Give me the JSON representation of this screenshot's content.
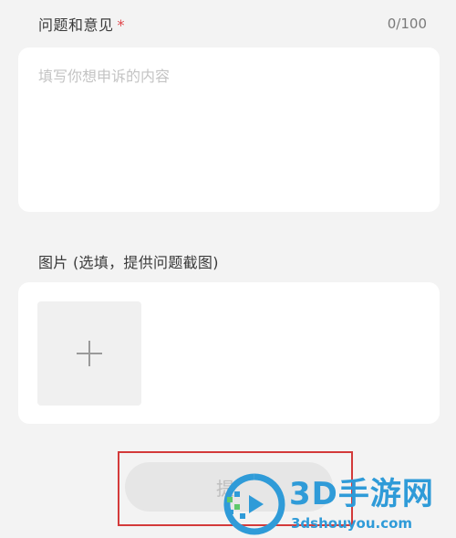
{
  "feedback": {
    "label": "问题和意见",
    "required_mark": "*",
    "counter": "0/100",
    "placeholder": "填写你想申诉的内容"
  },
  "images": {
    "label": "图片 (选填，提供问题截图)",
    "add_icon": "plus-icon"
  },
  "submit": {
    "label": "提交",
    "visible_label": "提"
  },
  "watermark": {
    "title": "3D手游网",
    "domain": "3dshouyou.com"
  },
  "colors": {
    "background": "#f3f3f3",
    "card": "#ffffff",
    "required": "#e0454a",
    "highlight": "#d33a3a",
    "watermark": "#2f9bd8",
    "button": "#e6e6e6"
  }
}
